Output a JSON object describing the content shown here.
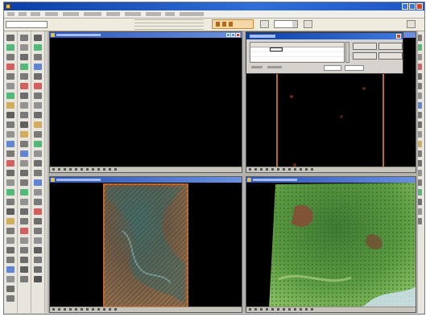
{
  "colors": {
    "window_title": "#1d55c8",
    "window_chrome": "#d6d3ce",
    "image_background": "#000000",
    "frame_outline": "#c56a2a",
    "dialog_title": "#0b3fa8"
  },
  "title_bar": {
    "icons": [
      "app-icon",
      "minimize-icon",
      "maximize-icon",
      "close-icon"
    ]
  },
  "viewers": [
    {
      "name": "viewer-1",
      "content": "empty"
    },
    {
      "name": "viewer-2",
      "content": "dark-image-with-markers"
    },
    {
      "name": "viewer-3",
      "content": "true-color-mosaic"
    },
    {
      "name": "viewer-4",
      "content": "vegetation-composite"
    }
  ],
  "dialog": {
    "grid_rows": 3,
    "buttons": 4
  }
}
